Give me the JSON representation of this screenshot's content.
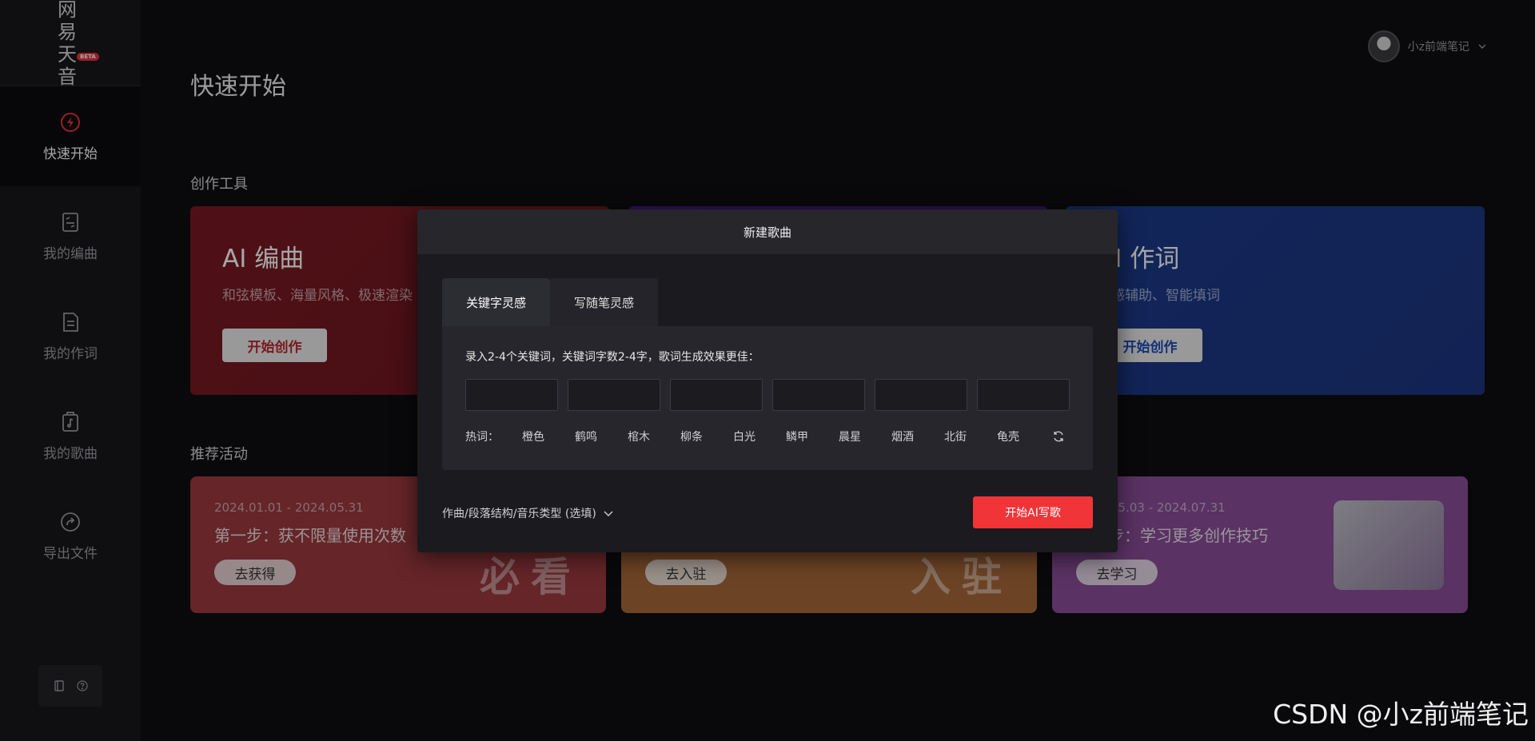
{
  "sidebar": {
    "logo_text": "网易天音",
    "logo_badge": "BETA",
    "items": [
      {
        "label": "快速开始",
        "icon": "lightning-icon",
        "active": true
      },
      {
        "label": "我的编曲",
        "icon": "score-icon"
      },
      {
        "label": "我的作词",
        "icon": "lyrics-doc-icon"
      },
      {
        "label": "我的歌曲",
        "icon": "music-bag-icon"
      },
      {
        "label": "导出文件",
        "icon": "share-arrow-icon"
      }
    ]
  },
  "header": {
    "title": "快速开始",
    "user_name": "小z前端笔记"
  },
  "tools": {
    "section_label": "创作工具",
    "cards": [
      {
        "title": "AI 编曲",
        "subtitle": "和弦模板、海量风格、极速渲染",
        "button": "开始创作"
      },
      {
        "title": "",
        "subtitle": "",
        "button": ""
      },
      {
        "title": "AI 作词",
        "subtitle": "灵感辅助、智能填词",
        "button": "开始创作"
      }
    ]
  },
  "promos": {
    "section_label": "推荐活动",
    "cards": [
      {
        "date": "2024.01.01 - 2024.05.31",
        "text": "第一步：获不限量使用次数",
        "button": "去获得",
        "stamp": "必看"
      },
      {
        "date": "",
        "text": "",
        "button": "去入驻",
        "stamp": "入驻"
      },
      {
        "date": "2024.05.03 - 2024.07.31",
        "text": "第三步：学习更多创作技巧",
        "button": "去学习",
        "stamp": ""
      }
    ]
  },
  "modal": {
    "title": "新建歌曲",
    "tabs": [
      "关键字灵感",
      "写随笔灵感"
    ],
    "hint": "录入2-4个关键词，关键词字数2-4字，歌词生成效果更佳：",
    "inputs": [
      "",
      "",
      "",
      "",
      "",
      ""
    ],
    "hot_label": "热词：",
    "hot_words": [
      "橙色",
      "鹤鸣",
      "棺木",
      "柳条",
      "白光",
      "鳞甲",
      "晨星",
      "烟酒",
      "北街",
      "龟壳"
    ],
    "options_label": "作曲/段落结构/音乐类型 (选填)",
    "submit": "开始AI写歌"
  },
  "watermark": "CSDN @小z前端笔记",
  "colors": {
    "accent": "#f03438",
    "background": "#0e0e12",
    "sidebar": "#17171b"
  }
}
